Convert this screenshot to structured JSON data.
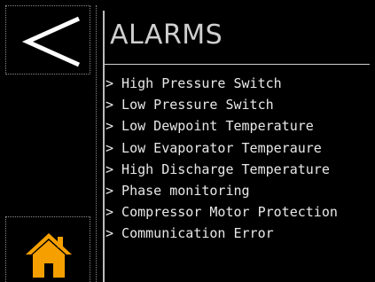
{
  "nav": {
    "back_icon": "chevron-left-icon",
    "home_icon": "home-icon",
    "home_color": "#f5a000"
  },
  "screen": {
    "title": "ALARMS"
  },
  "alarms": [
    {
      "label": "> High Pressure Switch"
    },
    {
      "label": "> Low Pressure Switch"
    },
    {
      "label": "> Low Dewpoint Temperature"
    },
    {
      "label": "> Low Evaporator Temperaure"
    },
    {
      "label": "> High Discharge Temperature"
    },
    {
      "label": "> Phase monitoring"
    },
    {
      "label": "> Compressor Motor Protection"
    },
    {
      "label": "> Communication Error"
    }
  ]
}
